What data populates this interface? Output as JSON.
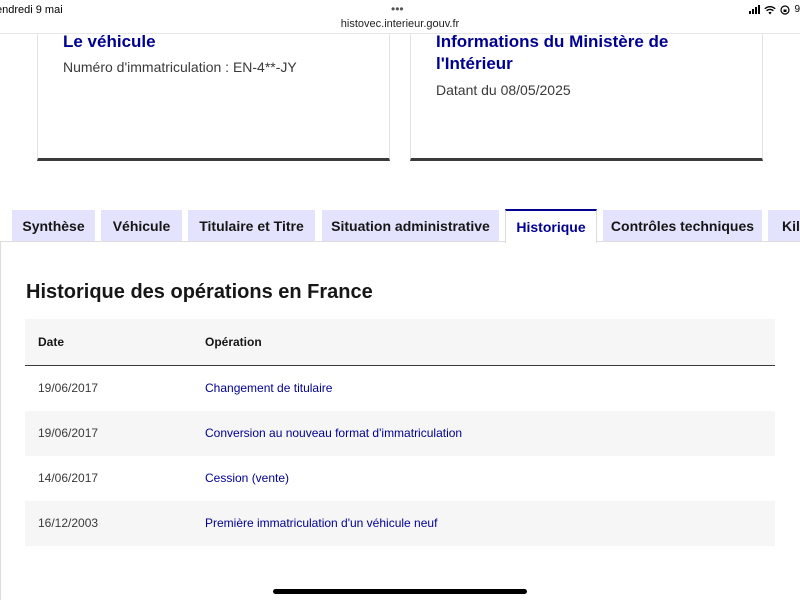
{
  "status_bar": {
    "date": "endredi 9 mai",
    "dots": "•••",
    "url": "histovec.interieur.gouv.fr",
    "battery": "9"
  },
  "cards": [
    {
      "title": "Le véhicule",
      "subtitle": "Numéro d'immatriculation : EN-4**-JY"
    },
    {
      "title": "Informations du Ministère de l'Intérieur",
      "subtitle": "Datant du 08/05/2025"
    }
  ],
  "tabs": [
    {
      "label": "Synthèse",
      "active": false
    },
    {
      "label": "Véhicule",
      "active": false
    },
    {
      "label": "Titulaire et Titre",
      "active": false
    },
    {
      "label": "Situation administrative",
      "active": false
    },
    {
      "label": "Historique",
      "active": true
    },
    {
      "label": "Contrôles techniques",
      "active": false
    },
    {
      "label": "Kil",
      "active": false
    }
  ],
  "section": {
    "title": "Historique des opérations en France"
  },
  "table": {
    "headers": {
      "date": "Date",
      "operation": "Opération"
    },
    "rows": [
      {
        "date": "19/06/2017",
        "operation": "Changement de titulaire"
      },
      {
        "date": "19/06/2017",
        "operation": "Conversion au nouveau format d'immatriculation"
      },
      {
        "date": "14/06/2017",
        "operation": "Cession (vente)"
      },
      {
        "date": "16/12/2003",
        "operation": "Première immatriculation d'un véhicule neuf"
      }
    ]
  },
  "colors": {
    "accent": "#000091",
    "tab_background": "#e3e3fd",
    "row_alt": "#f6f6f6"
  }
}
